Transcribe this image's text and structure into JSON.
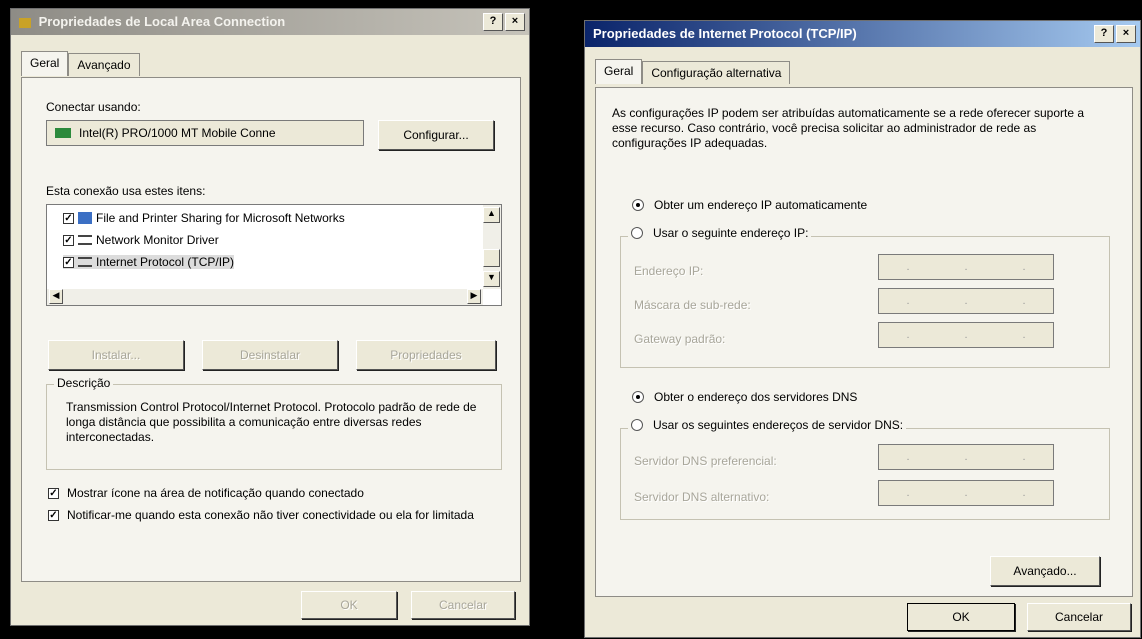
{
  "dialog1": {
    "title": "Propriedades de Local Area Connection",
    "help_label": "?",
    "close_label": "×",
    "tabs": [
      {
        "label": "Geral"
      },
      {
        "label": "Avançado"
      }
    ],
    "connect_using_label": "Conectar usando:",
    "adapter_name": "Intel(R) PRO/1000 MT Mobile Conne",
    "configure_label": "Configurar...",
    "items_label": "Esta conexão usa estes itens:",
    "items": [
      {
        "label": "File and Printer Sharing for Microsoft Networks",
        "checked": "✓"
      },
      {
        "label": "Network Monitor Driver",
        "checked": "✓"
      },
      {
        "label": "Internet Protocol (TCP/IP)",
        "checked": "✓"
      }
    ],
    "install_label": "Instalar...",
    "uninstall_label": "Desinstalar",
    "properties_label": "Propriedades",
    "description_label": "Descrição",
    "description_text": "Transmission Control Protocol/Internet Protocol. Protocolo padrão de rede de longa distância que possibilita a comunicação entre diversas redes interconectadas.",
    "show_icon_label": "Mostrar ícone na área de notificação quando conectado",
    "notify_label": "Notificar-me quando esta conexão não tiver conectividade ou ela for limitada",
    "ok_label": "OK",
    "cancel_label": "Cancelar"
  },
  "dialog2": {
    "title": "Propriedades de Internet Protocol (TCP/IP)",
    "help_label": "?",
    "close_label": "×",
    "tabs": [
      {
        "label": "Geral"
      },
      {
        "label": "Configuração alternativa"
      }
    ],
    "intro_text": "As configurações IP podem ser atribuídas automaticamente se a rede oferecer suporte a esse recurso. Caso contrário, você precisa solicitar ao administrador de rede as configurações IP adequadas.",
    "auto_ip_label": "Obter um endereço IP automaticamente",
    "manual_ip_label": "Usar o seguinte endereço IP:",
    "ip_address_label": "Endereço IP:",
    "subnet_label": "Máscara de sub-rede:",
    "gateway_label": "Gateway padrão:",
    "auto_dns_label": "Obter o endereço dos servidores DNS",
    "manual_dns_label": "Usar os seguintes endereços de servidor DNS:",
    "preferred_dns_label": "Servidor DNS preferencial:",
    "alternate_dns_label": "Servidor DNS alternativo:",
    "ip_dot": ".",
    "advanced_label": "Avançado...",
    "ok_label": "OK",
    "cancel_label": "Cancelar"
  }
}
